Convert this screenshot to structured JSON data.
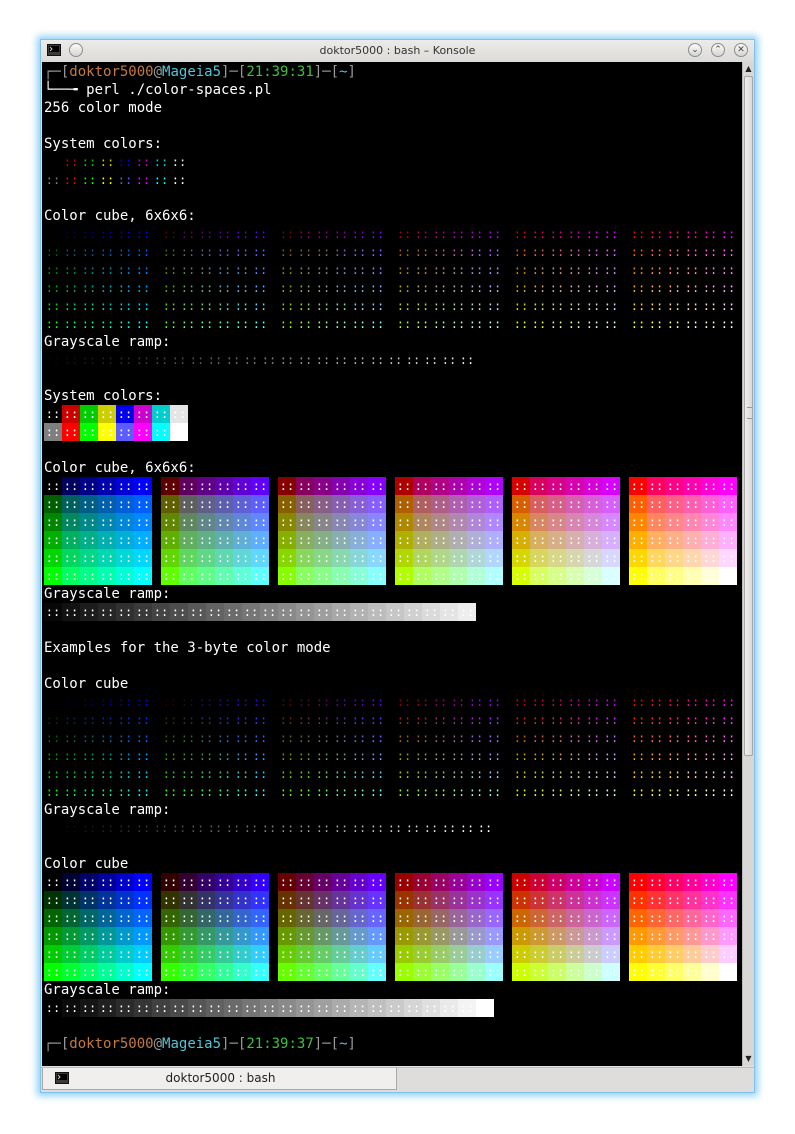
{
  "window": {
    "title": "doktor5000 : bash – Konsole",
    "tab_label": "doktor5000 : bash",
    "icons": {
      "app": "terminal-icon",
      "menu": "window-menu-icon",
      "minimize": "minimize-icon",
      "maximize": "maximize-icon",
      "close": "close-icon"
    }
  },
  "prompt1": {
    "open": "┌─[",
    "user": "doktor5000",
    "at": "@",
    "host": "Mageia5",
    "mid1": "]─[",
    "time": "21:39:31",
    "mid2": "]─[",
    "path": "~",
    "close": "]"
  },
  "command_line": "└──╼ perl ./color-spaces.pl",
  "mode_line": "256 color mode",
  "sections": {
    "sys1": "System colors:",
    "cube1": "Color cube, 6x6x6:",
    "gray1": "Grayscale ramp:",
    "sys2": "System colors:",
    "cube2": "Color cube, 6x6x6:",
    "gray2": "Grayscale ramp:",
    "examples": "Examples for the 3-byte color mode",
    "cube3": "Color cube",
    "gray3": "Grayscale ramp:",
    "cube4": "Color cube",
    "gray4": "Grayscale ramp:"
  },
  "prompt2": {
    "open": "┌─[",
    "user": "doktor5000",
    "at": "@",
    "host": "Mageia5",
    "mid1": "]─[",
    "time": "21:39:37",
    "mid2": "]─[",
    "path": "~",
    "close": "]"
  },
  "cell_glyph": "::",
  "system_colors": [
    "#000000",
    "#cd0000",
    "#00cd00",
    "#cdcd00",
    "#0000ee",
    "#cd00cd",
    "#00cdcd",
    "#e5e5e5",
    "#7f7f7f",
    "#ff0000",
    "#00ff00",
    "#ffff00",
    "#5c5cff",
    "#ff00ff",
    "#00ffff",
    "#ffffff"
  ],
  "cube_levels": [
    0,
    95,
    135,
    175,
    215,
    255
  ],
  "examples_cube_levels": [
    0,
    51,
    102,
    153,
    204,
    255
  ],
  "grayscale_count": 24,
  "examples_grayscale_count": 25
}
